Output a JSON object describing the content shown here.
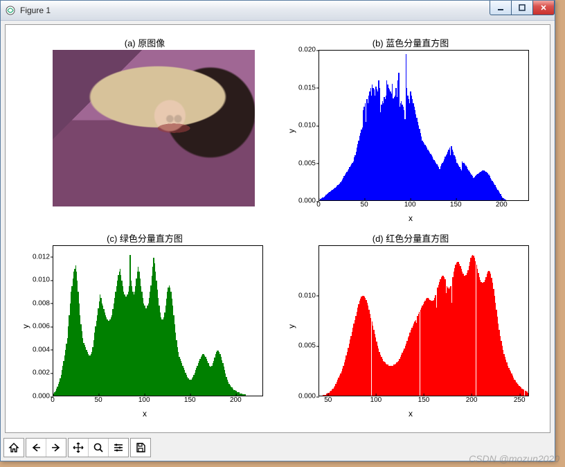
{
  "window": {
    "title": "Figure 1",
    "buttons": {
      "min_tip": "Minimize",
      "max_tip": "Maximize",
      "close_tip": "Close"
    }
  },
  "watermark": "CSDN @mozun2020",
  "toolbar": {
    "home": "Home",
    "back": "Back",
    "forward": "Forward",
    "pan": "Pan",
    "zoom": "Zoom",
    "configure": "Configure subplots",
    "save": "Save"
  },
  "panels": {
    "a": {
      "title": "(a) 原图像"
    },
    "b": {
      "title": "(b) 蓝色分量直方图",
      "xlabel": "x",
      "ylabel": "y"
    },
    "c": {
      "title": "(c) 绿色分量直方图",
      "xlabel": "x",
      "ylabel": "y"
    },
    "d": {
      "title": "(d) 红色分量直方图",
      "xlabel": "x",
      "ylabel": "y"
    }
  },
  "chart_data": [
    {
      "id": "b",
      "type": "bar",
      "title": "(b) 蓝色分量直方图",
      "xlabel": "x",
      "ylabel": "y",
      "color": "#0000ff",
      "xlim": [
        0,
        230
      ],
      "ylim": [
        0,
        0.02
      ],
      "xticks": [
        0,
        50,
        100,
        150,
        200
      ],
      "yticks": [
        0.0,
        0.005,
        0.01,
        0.015,
        0.02
      ],
      "x_step": 1,
      "x_start": 0,
      "values": [
        0,
        0.0002,
        0.0003,
        0.0004,
        0.0004,
        0.0005,
        0.0006,
        0.0007,
        0.0008,
        0.0009,
        0.001,
        0.0011,
        0.0012,
        0.0013,
        0.0014,
        0.0015,
        0.0016,
        0.0017,
        0.0018,
        0.0019,
        0.002,
        0.0021,
        0.0022,
        0.0024,
        0.0026,
        0.0028,
        0.003,
        0.0032,
        0.0034,
        0.0036,
        0.0038,
        0.004,
        0.0042,
        0.0044,
        0.0046,
        0.0048,
        0.005,
        0.0052,
        0.0057,
        0.006,
        0.0065,
        0.007,
        0.0075,
        0.008,
        0.0086,
        0.009,
        0.0094,
        0.0097,
        0.012,
        0.0125,
        0.013,
        0.0105,
        0.0135,
        0.013,
        0.014,
        0.0145,
        0.015,
        0.014,
        0.0155,
        0.015,
        0.0148,
        0.014,
        0.0152,
        0.0148,
        0.0145,
        0.016,
        0.015,
        0.0118,
        0.0128,
        0.0132,
        0.013,
        0.0138,
        0.0135,
        0.014,
        0.016,
        0.0155,
        0.015,
        0.0148,
        0.0145,
        0.0143,
        0.0156,
        0.0136,
        0.0138,
        0.014,
        0.015,
        0.0138,
        0.016,
        0.017,
        0.0125,
        0.013,
        0.0132,
        0.0128,
        0.0125,
        0.012,
        0.0108,
        0.0195,
        0.015,
        0.014,
        0.0135,
        0.013,
        0.0145,
        0.014,
        0.0135,
        0.013,
        0.0125,
        0.012,
        0.0115,
        0.011,
        0.0105,
        0.01,
        0.0095,
        0.009,
        0.0085,
        0.008,
        0.0078,
        0.0076,
        0.0074,
        0.0072,
        0.007,
        0.0068,
        0.0066,
        0.0064,
        0.0062,
        0.006,
        0.0058,
        0.0056,
        0.0054,
        0.0052,
        0.005,
        0.0048,
        0.0046,
        0.0044,
        0.0042,
        0.0045,
        0.0048,
        0.005,
        0.0052,
        0.0055,
        0.0058,
        0.006,
        0.0062,
        0.0065,
        0.0068,
        0.007,
        0.006,
        0.0072,
        0.0068,
        0.0065,
        0.006,
        0.0058,
        0.0055,
        0.005,
        0.0048,
        0.0046,
        0.0044,
        0.0042,
        0.004,
        0.0052,
        0.005,
        0.005,
        0.0048,
        0.0046,
        0.0044,
        0.0042,
        0.004,
        0.0038,
        0.0036,
        0.0034,
        0.0032,
        0.003,
        0.0031,
        0.0032,
        0.0033,
        0.0034,
        0.0035,
        0.0036,
        0.0037,
        0.0038,
        0.0039,
        0.004,
        0.004,
        0.004,
        0.0039,
        0.0038,
        0.0037,
        0.0036,
        0.0034,
        0.0032,
        0.003,
        0.0028,
        0.0026,
        0.0024,
        0.0022,
        0.002,
        0.0018,
        0.0016,
        0.0014,
        0.0012,
        0.001,
        0.0008,
        0.0006,
        0.0004,
        0.0003,
        0.0002,
        0.0001,
        0.0001,
        0,
        0,
        0,
        0,
        0,
        0,
        0,
        0,
        0,
        0,
        0,
        0,
        0,
        0,
        0,
        0,
        0,
        0,
        0,
        0,
        0,
        0,
        0,
        0,
        0,
        0,
        0
      ]
    },
    {
      "id": "c",
      "type": "bar",
      "title": "(c) 绿色分量直方图",
      "xlabel": "x",
      "ylabel": "y",
      "color": "#008000",
      "xlim": [
        0,
        230
      ],
      "ylim": [
        0,
        0.013
      ],
      "xticks": [
        0,
        50,
        100,
        150,
        200
      ],
      "yticks": [
        0.0,
        0.002,
        0.004,
        0.006,
        0.008,
        0.01,
        0.012
      ],
      "x_step": 1,
      "x_start": 0,
      "values": [
        0.0002,
        0.0003,
        0.0004,
        0.0006,
        0.0008,
        0.001,
        0.0012,
        0.0015,
        0.0018,
        0.0022,
        0.0026,
        0.003,
        0.0035,
        0.004,
        0.0045,
        0.005,
        0.006,
        0.007,
        0.008,
        0.009,
        0.0095,
        0.0102,
        0.0108,
        0.011,
        0.0113,
        0.0108,
        0.01,
        0.009,
        0.008,
        0.007,
        0.0062,
        0.0056,
        0.005,
        0.0046,
        0.0044,
        0.0042,
        0.004,
        0.0038,
        0.0036,
        0.0035,
        0.0035,
        0.0036,
        0.0038,
        0.0042,
        0.0048,
        0.0055,
        0.006,
        0.0065,
        0.007,
        0.0076,
        0.0082,
        0.0088,
        0.0085,
        0.008,
        0.0078,
        0.0075,
        0.0072,
        0.007,
        0.0068,
        0.0066,
        0.0065,
        0.0065,
        0.0066,
        0.0068,
        0.007,
        0.0075,
        0.008,
        0.0085,
        0.009,
        0.0095,
        0.01,
        0.0105,
        0.0108,
        0.011,
        0.0105,
        0.01,
        0.0095,
        0.009,
        0.0088,
        0.0086,
        0.0086,
        0.0088,
        0.009,
        0.0095,
        0.0122,
        0.01,
        0.0095,
        0.009,
        0.0088,
        0.009,
        0.0095,
        0.0102,
        0.0108,
        0.0112,
        0.0108,
        0.0102,
        0.0095,
        0.009,
        0.0085,
        0.008,
        0.0078,
        0.0076,
        0.0076,
        0.0078,
        0.008,
        0.0085,
        0.009,
        0.0096,
        0.0104,
        0.0112,
        0.012,
        0.0115,
        0.0108,
        0.01,
        0.0092,
        0.0085,
        0.0078,
        0.0072,
        0.0068,
        0.0066,
        0.0066,
        0.0068,
        0.0072,
        0.0078,
        0.0084,
        0.009,
        0.0094,
        0.0096,
        0.0094,
        0.009,
        0.0084,
        0.0078,
        0.007,
        0.0062,
        0.0055,
        0.0048,
        0.0042,
        0.0038,
        0.0034,
        0.0032,
        0.003,
        0.0028,
        0.0026,
        0.0024,
        0.0022,
        0.002,
        0.0018,
        0.0016,
        0.0015,
        0.0014,
        0.0014,
        0.0014,
        0.0015,
        0.0016,
        0.0018,
        0.002,
        0.0022,
        0.0024,
        0.0026,
        0.0028,
        0.003,
        0.0032,
        0.0034,
        0.0035,
        0.0036,
        0.0036,
        0.0035,
        0.0034,
        0.0032,
        0.003,
        0.0028,
        0.0026,
        0.0025,
        0.0025,
        0.0026,
        0.0028,
        0.003,
        0.0033,
        0.0036,
        0.0038,
        0.0039,
        0.0039,
        0.0038,
        0.0036,
        0.0034,
        0.0031,
        0.0028,
        0.0025,
        0.0022,
        0.0019,
        0.0016,
        0.0014,
        0.0012,
        0.001,
        0.0009,
        0.0008,
        0.0007,
        0.0006,
        0.0005,
        0.0005,
        0.0004,
        0.0004,
        0.0003,
        0.0003,
        0.0003,
        0.0002,
        0.0002,
        0.0002,
        0.0001,
        0.0001,
        0.0001,
        0.0001,
        0,
        0,
        0,
        0,
        0,
        0,
        0,
        0,
        0,
        0,
        0,
        0,
        0,
        0,
        0,
        0
      ]
    },
    {
      "id": "d",
      "type": "bar",
      "title": "(d) 红色分量直方图",
      "xlabel": "x",
      "ylabel": "y",
      "color": "#ff0000",
      "xlim": [
        40,
        260
      ],
      "ylim": [
        0,
        0.015
      ],
      "xticks": [
        50,
        100,
        150,
        200,
        250
      ],
      "yticks": [
        0.0,
        0.005,
        0.01
      ],
      "x_step": 1,
      "x_start": 40,
      "values": [
        0,
        0,
        0,
        0,
        0.0001,
        0.0001,
        0.0001,
        0.0002,
        0.0002,
        0.0003,
        0.0003,
        0.0004,
        0.0005,
        0.0006,
        0.0007,
        0.0008,
        0.001,
        0.0012,
        0.0014,
        0.0016,
        0.0018,
        0.002,
        0.0022,
        0.0024,
        0.0027,
        0.003,
        0.0033,
        0.0036,
        0.004,
        0.0044,
        0.0048,
        0.0052,
        0.0056,
        0.006,
        0.0064,
        0.0068,
        0.0072,
        0.0076,
        0.008,
        0.0084,
        0.0088,
        0.0092,
        0.0095,
        0.0097,
        0.0099,
        0.01,
        0.01,
        0.0099,
        0.0098,
        0.0096,
        0.0093,
        0.009,
        0.0086,
        0.0082,
        0.0078,
        0.0074,
        0.007,
        0.0066,
        0.0062,
        0.0058,
        0.0054,
        0.005,
        0.0047,
        0.0044,
        0.0041,
        0.0039,
        0.0037,
        0.0035,
        0.0034,
        0.0033,
        0.0032,
        0.0031,
        0.0031,
        0.003,
        0.003,
        0.003,
        0.003,
        0.003,
        0.0031,
        0.0031,
        0.0032,
        0.0033,
        0.0034,
        0.0035,
        0.0037,
        0.0039,
        0.0041,
        0.0043,
        0.0045,
        0.0047,
        0.005,
        0.0052,
        0.0055,
        0.0058,
        0.006,
        0.0063,
        0.0066,
        0.0068,
        0.007,
        0.0072,
        0.0074,
        0.0076,
        0.0073,
        0.008,
        0.0082,
        0.0084,
        0.0086,
        0.0088,
        0.009,
        0.0092,
        0.0094,
        0.0095,
        0.0097,
        0.0098,
        0.0098,
        0.0097,
        0.0096,
        0.0095,
        0.0095,
        0.0095,
        0.0096,
        0.0098,
        0.0101,
        0.0088,
        0.0108,
        0.0111,
        0.0114,
        0.0117,
        0.0119,
        0.012,
        0.012,
        0.0119,
        0.0117,
        0.0103,
        0.011,
        0.0108,
        0.0107,
        0.0108,
        0.011,
        0.0093,
        0.0119,
        0.0124,
        0.0128,
        0.0131,
        0.0133,
        0.0134,
        0.0134,
        0.0132,
        0.013,
        0.0127,
        0.0124,
        0.0122,
        0.012,
        0.012,
        0.0121,
        0.0123,
        0.0126,
        0.013,
        0.0134,
        0.0138,
        0.014,
        0.0141,
        0.014,
        0.0138,
        0.0135,
        0.0131,
        0.0127,
        0.0123,
        0.0119,
        0.0116,
        0.0114,
        0.0113,
        0.0113,
        0.0114,
        0.0116,
        0.0119,
        0.0122,
        0.0124,
        0.0125,
        0.0124,
        0.0122,
        0.0118,
        0.0113,
        0.0107,
        0.01,
        0.0093,
        0.0086,
        0.0079,
        0.0072,
        0.0066,
        0.006,
        0.0055,
        0.005,
        0.0046,
        0.0042,
        0.0039,
        0.0036,
        0.0033,
        0.003,
        0.0028,
        0.0026,
        0.0024,
        0.0022,
        0.002,
        0.0018,
        0.0016,
        0.0015,
        0.0013,
        0.0012,
        0.0011,
        0.001,
        0.0009,
        0.0008,
        0.0007,
        0.0006,
        0.0006,
        0.0005,
        0.0005,
        0.0004,
        0.0003
      ]
    }
  ]
}
